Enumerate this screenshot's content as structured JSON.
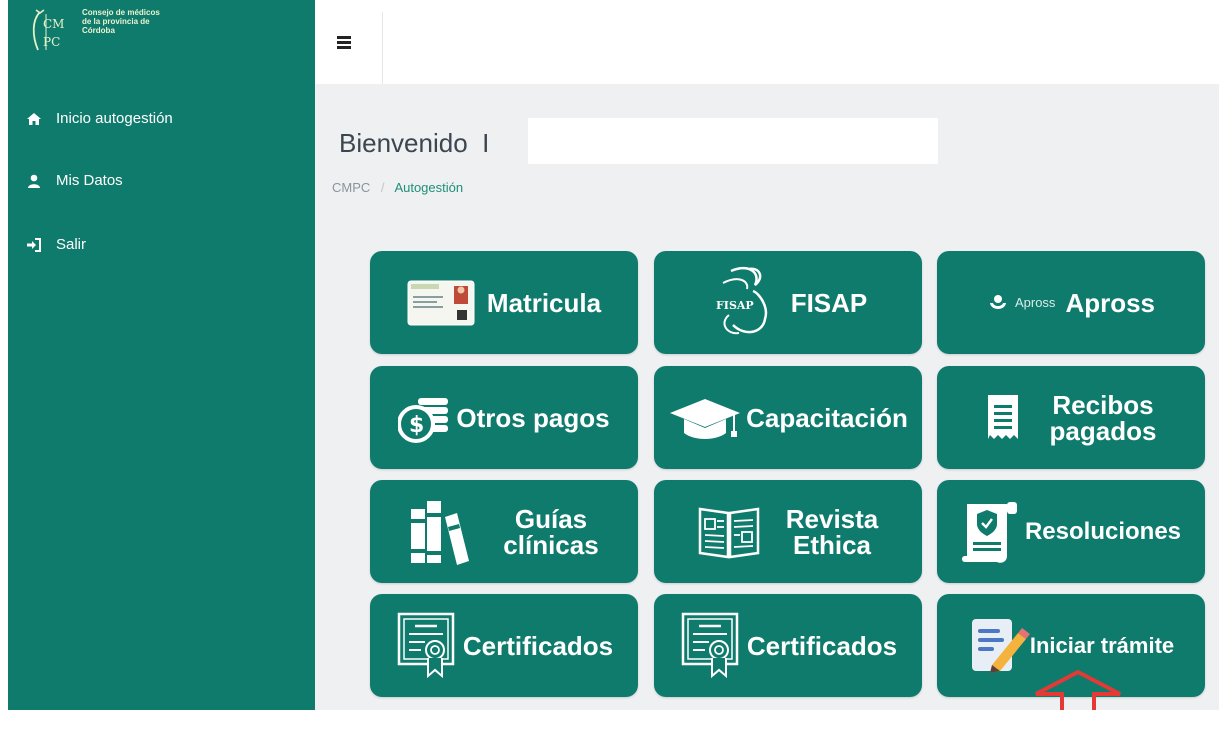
{
  "app": {
    "logo_text": "Consejo de médicos de la provincia de Córdoba",
    "logo_letters": "CMPC"
  },
  "sidebar": {
    "items": [
      {
        "label": "Inicio autogestión",
        "icon": "home-icon"
      },
      {
        "label": "Mis Datos",
        "icon": "user-icon"
      },
      {
        "label": "Salir",
        "icon": "sign-in-icon"
      }
    ]
  },
  "header": {
    "welcome": "Bienvenido",
    "breadcrumb": [
      "CMPC",
      "Autogestión"
    ]
  },
  "tiles": [
    {
      "label": "Matricula",
      "icon": "id-card-icon"
    },
    {
      "label": "FISAP",
      "icon": "fisap-logo-icon",
      "icon_text": "FISAP"
    },
    {
      "label": "Apross",
      "icon": "apross-logo-icon",
      "icon_text": "Apross"
    },
    {
      "label": "Otros pagos",
      "icon": "coins-icon"
    },
    {
      "label": "Capacitación",
      "icon": "graduation-cap-icon"
    },
    {
      "label_line1": "Recibos",
      "label_line2": "pagados",
      "icon": "receipt-icon"
    },
    {
      "label_line1": "Guías",
      "label_line2": "clínicas",
      "icon": "books-icon"
    },
    {
      "label_line1": "Revista",
      "label_line2": "Ethica",
      "icon": "open-book-icon"
    },
    {
      "label": "Resoluciones",
      "icon": "scroll-shield-icon"
    },
    {
      "label": "Certificados",
      "icon": "certificate-icon"
    },
    {
      "label": "Certificados",
      "icon": "certificate-icon"
    },
    {
      "label": "Iniciar trámite",
      "icon": "document-edit-icon"
    }
  ],
  "colors": {
    "brand": "#0f7b6c",
    "arrow": "#e53935",
    "background": "#eef0f2"
  }
}
